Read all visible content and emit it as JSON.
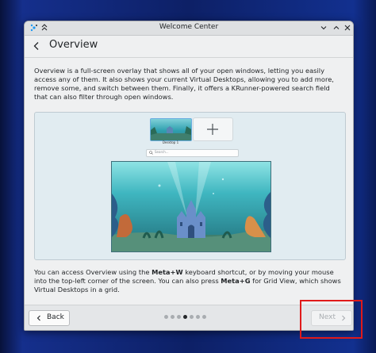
{
  "window": {
    "title": "Welcome Center"
  },
  "titlebar": {
    "app_icon": "kde-logo-icon",
    "pin_icon": "keep-above-icon",
    "minimize_icon": "chevron-down-icon",
    "maximize_icon": "chevron-up-icon",
    "close_icon": "close-icon"
  },
  "header": {
    "back_icon": "back-arrow-icon",
    "title": "Overview"
  },
  "description": "Overview is a full-screen overlay that shows all of your open windows, letting you easily access any of them. It also shows your current Virtual Desktops, allowing you to add more, remove some, and switch between them. Finally, it offers a KRunner-powered search field that can also filter through open windows.",
  "preview": {
    "desktop_label": "Desktop 1",
    "add_icon": "plus-icon",
    "search_placeholder": "Search..."
  },
  "body2": {
    "p1": "You can access Overview using the ",
    "k1": "Meta+W",
    "p2": " keyboard shortcut, or by moving your mouse into the top-left corner of the screen. You can also press ",
    "k2": "Meta+G",
    "p3": " for Grid View, which shows Virtual Desktops in a grid."
  },
  "footer": {
    "back_label": "Back",
    "next_label": "Next",
    "page_count": 7,
    "active_page": 4
  },
  "colors": {
    "accent": "#3daee9",
    "highlight_box": "#e01a1a",
    "text": "#232629"
  }
}
